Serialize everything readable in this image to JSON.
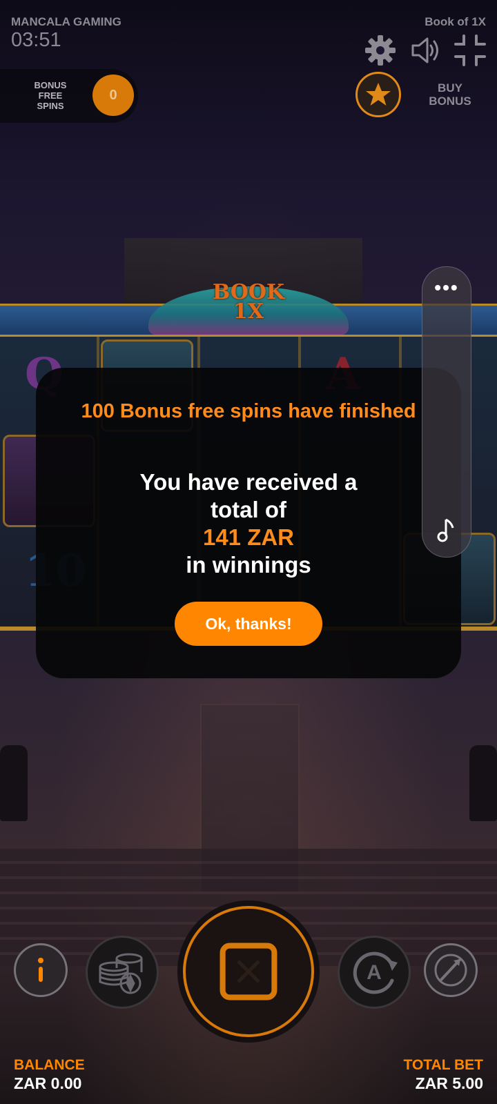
{
  "header": {
    "brand": "MANCALA GAMING",
    "clock": "03:51",
    "game_title": "Book of 1X",
    "icons": [
      "gear-icon",
      "speaker-icon",
      "exit-fullscreen-icon"
    ]
  },
  "bonus_free_spins": {
    "label": "BONUS\nFREE\nSPINS",
    "count": "0"
  },
  "buy_bonus": {
    "label": "BUY\nBONUS",
    "icon": "star-icon"
  },
  "logo": {
    "text": "BOOK\n1X"
  },
  "side_menu": {
    "dots": "•••",
    "icons": [
      "more-dots-icon",
      "music-note-icon"
    ]
  },
  "modal": {
    "title": "100 Bonus free spins have finished",
    "line1": "You have received a",
    "line2": "total of",
    "amount": "141 ZAR",
    "line3": "in winnings",
    "button_label": "Ok, thanks!"
  },
  "controls": {
    "icons": [
      "info-icon",
      "coins-bet-icon",
      "stop-spin-icon",
      "autoplay-icon",
      "turbo-icon"
    ]
  },
  "footer": {
    "balance_label": "BALANCE",
    "balance_value": "ZAR 0.00",
    "total_bet_label": "TOTAL BET",
    "total_bet_value": "ZAR 5.00"
  },
  "colors": {
    "accent": "#ff8600",
    "text_muted": "#8d8a94",
    "modal_bg": "#060608"
  }
}
